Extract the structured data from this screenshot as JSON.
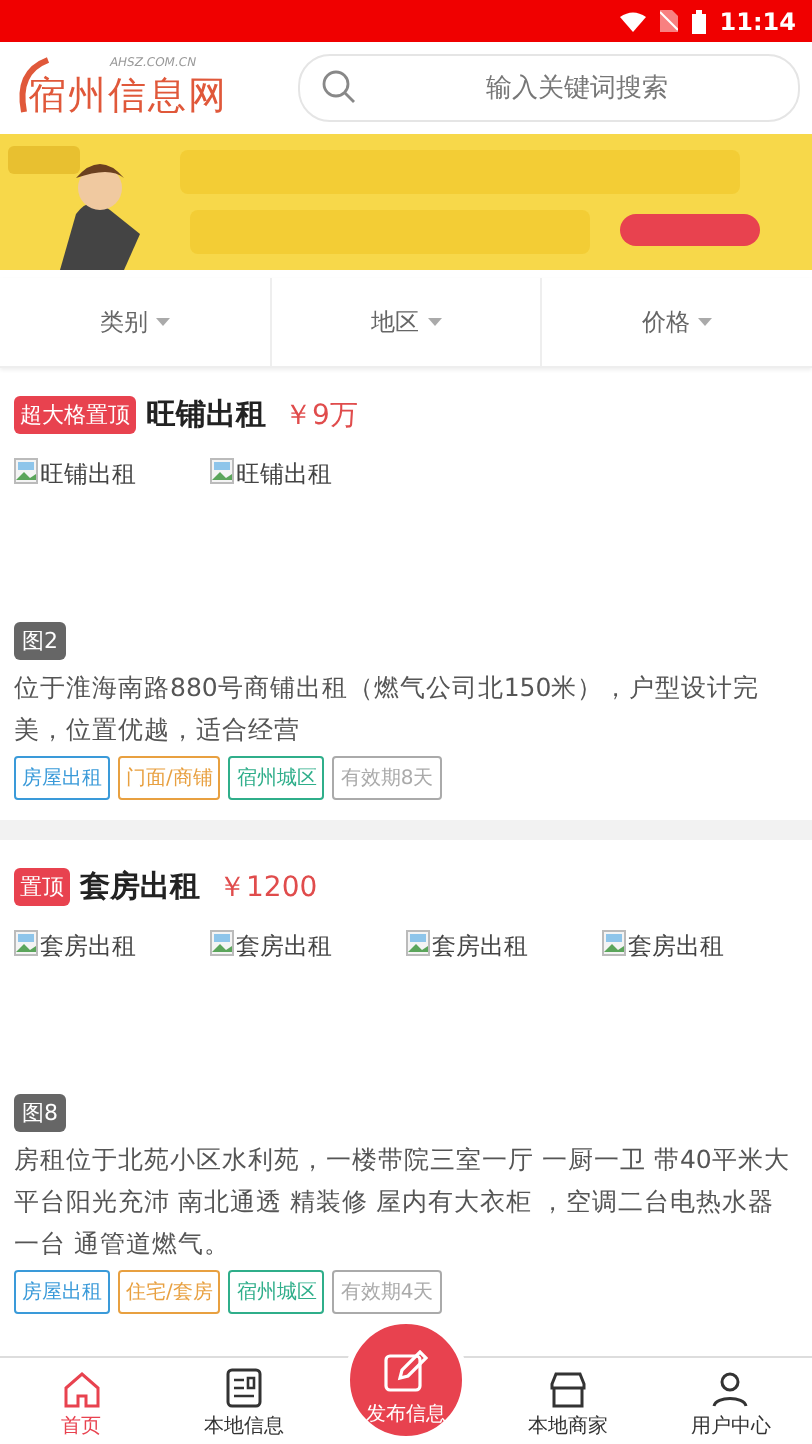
{
  "status_bar": {
    "time": "11:14"
  },
  "header": {
    "logo": {
      "domain": "AHSZ.COM.CN",
      "name": "宿州信息网"
    },
    "search": {
      "placeholder": "输入关键词搜索"
    }
  },
  "filters": [
    {
      "label": "类别"
    },
    {
      "label": "地区"
    },
    {
      "label": "价格"
    }
  ],
  "listings": [
    {
      "badge": "超大格置顶",
      "title": "旺铺出租",
      "price": "￥9万",
      "images": [
        "旺铺出租",
        "旺铺出租"
      ],
      "image_count": "图2",
      "description": "位于淮海南路880号商铺出租（燃气公司北150米），户型设计完美，位置优越，适合经营",
      "tags": [
        {
          "label": "房屋出租",
          "color": "#3a9ad9"
        },
        {
          "label": "门面/商铺",
          "color": "#e8a040"
        },
        {
          "label": "宿州城区",
          "color": "#2fae8a"
        },
        {
          "label": "有效期8天",
          "color": "#aaaaaa"
        }
      ]
    },
    {
      "badge": "置顶",
      "title": "套房出租",
      "price": "￥1200",
      "images": [
        "套房出租",
        "套房出租",
        "套房出租",
        "套房出租"
      ],
      "image_count": "图8",
      "description": "房租位于北苑小区水利苑，一楼带院三室一厅 一厨一卫 带40平米大平台阳光充沛 南北通透 精装修 屋内有大衣柜 ，空调二台电热水器一台 通管道燃气。",
      "tags": [
        {
          "label": "房屋出租",
          "color": "#3a9ad9"
        },
        {
          "label": "住宅/套房",
          "color": "#e8a040"
        },
        {
          "label": "宿州城区",
          "color": "#2fae8a"
        },
        {
          "label": "有效期4天",
          "color": "#aaaaaa"
        }
      ]
    }
  ],
  "tab_bar": [
    {
      "label": "首页",
      "kind": "home",
      "selected": true
    },
    {
      "label": "本地信息",
      "kind": "news",
      "selected": false
    },
    {
      "label": "发布信息",
      "kind": "publish",
      "selected": false
    },
    {
      "label": "本地商家",
      "kind": "shop",
      "selected": false
    },
    {
      "label": "用户中心",
      "kind": "user",
      "selected": false
    }
  ]
}
